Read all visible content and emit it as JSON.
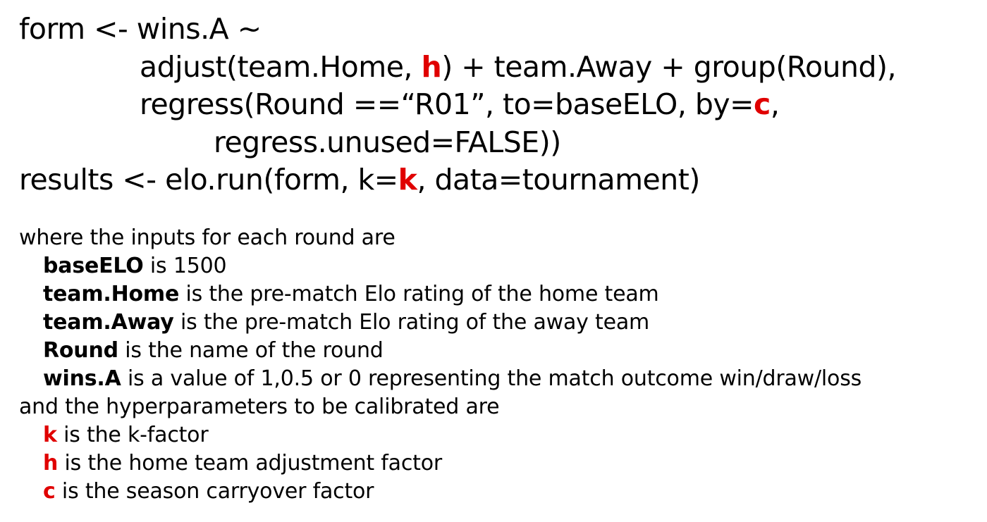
{
  "accent_color": "#e00000",
  "code": {
    "line1": {
      "text": "form <- wins.A ~"
    },
    "line2": {
      "pre": "adjust(team.Home, ",
      "param": "h",
      "post": ") + team.Away + group(Round),"
    },
    "line3": {
      "pre": "regress(Round ==“R01”, to=baseELO, by=",
      "param": "c",
      "post": ","
    },
    "line4": {
      "text": "regress.unused=FALSE))"
    },
    "line5": {
      "pre": "results <- elo.run(form, k=",
      "param": "k",
      "post": ", data=tournament)"
    }
  },
  "description": {
    "inputs_intro": "where the inputs for each round are",
    "inputs": [
      {
        "term": "baseELO",
        "desc": " is 1500"
      },
      {
        "term": "team.Home",
        "desc": " is the pre-match Elo rating of the home team"
      },
      {
        "term": "team.Away",
        "desc": " is the pre-match Elo rating of the away team"
      },
      {
        "term": "Round",
        "desc": " is the name of the round"
      },
      {
        "term": "wins.A",
        "desc": " is a value of 1,0.5 or 0 representing the match outcome win/draw/loss"
      }
    ],
    "hyper_intro": "and the hyperparameters to be calibrated are",
    "hyperparameters": [
      {
        "term": "k",
        "desc": " is the k-factor"
      },
      {
        "term": "h",
        "desc": " is the home team adjustment factor"
      },
      {
        "term": "c",
        "desc": " is the season carryover factor"
      }
    ]
  }
}
